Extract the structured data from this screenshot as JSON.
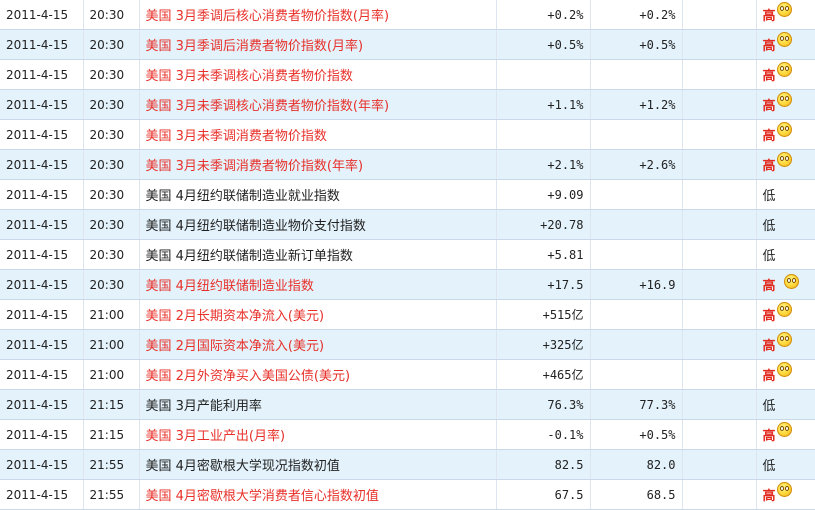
{
  "rows": [
    {
      "date": "2011-4-15",
      "time": "20:30",
      "event": "美国 3月季调后核心消费者物价指数(月率)",
      "prev": "+0.2%",
      "forecast": "+0.2%",
      "actual": "",
      "importance": "高",
      "level": "high",
      "face_far": false
    },
    {
      "date": "2011-4-15",
      "time": "20:30",
      "event": "美国 3月季调后消费者物价指数(月率)",
      "prev": "+0.5%",
      "forecast": "+0.5%",
      "actual": "",
      "importance": "高",
      "level": "high",
      "face_far": false
    },
    {
      "date": "2011-4-15",
      "time": "20:30",
      "event": "美国 3月未季调核心消费者物价指数",
      "prev": "",
      "forecast": "",
      "actual": "",
      "importance": "高",
      "level": "high",
      "face_far": false
    },
    {
      "date": "2011-4-15",
      "time": "20:30",
      "event": "美国 3月未季调核心消费者物价指数(年率)",
      "prev": "+1.1%",
      "forecast": "+1.2%",
      "actual": "",
      "importance": "高",
      "level": "high",
      "face_far": false
    },
    {
      "date": "2011-4-15",
      "time": "20:30",
      "event": "美国 3月未季调消费者物价指数",
      "prev": "",
      "forecast": "",
      "actual": "",
      "importance": "高",
      "level": "high",
      "face_far": false
    },
    {
      "date": "2011-4-15",
      "time": "20:30",
      "event": "美国 3月未季调消费者物价指数(年率)",
      "prev": "+2.1%",
      "forecast": "+2.6%",
      "actual": "",
      "importance": "高",
      "level": "high",
      "face_far": false
    },
    {
      "date": "2011-4-15",
      "time": "20:30",
      "event": "美国 4月纽约联储制造业就业指数",
      "prev": "+9.09",
      "forecast": "",
      "actual": "",
      "importance": "低",
      "level": "low",
      "face_far": false
    },
    {
      "date": "2011-4-15",
      "time": "20:30",
      "event": "美国 4月纽约联储制造业物价支付指数",
      "prev": "+20.78",
      "forecast": "",
      "actual": "",
      "importance": "低",
      "level": "low",
      "face_far": false
    },
    {
      "date": "2011-4-15",
      "time": "20:30",
      "event": "美国 4月纽约联储制造业新订单指数",
      "prev": "+5.81",
      "forecast": "",
      "actual": "",
      "importance": "低",
      "level": "low",
      "face_far": false
    },
    {
      "date": "2011-4-15",
      "time": "20:30",
      "event": "美国 4月纽约联储制造业指数",
      "prev": "+17.5",
      "forecast": "+16.9",
      "actual": "",
      "importance": "高",
      "level": "high",
      "face_far": true
    },
    {
      "date": "2011-4-15",
      "time": "21:00",
      "event": "美国 2月长期资本净流入(美元)",
      "prev": "+515亿",
      "forecast": "",
      "actual": "",
      "importance": "高",
      "level": "high",
      "face_far": false
    },
    {
      "date": "2011-4-15",
      "time": "21:00",
      "event": "美国 2月国际资本净流入(美元)",
      "prev": "+325亿",
      "forecast": "",
      "actual": "",
      "importance": "高",
      "level": "high",
      "face_far": false
    },
    {
      "date": "2011-4-15",
      "time": "21:00",
      "event": "美国 2月外资净买入美国公债(美元)",
      "prev": "+465亿",
      "forecast": "",
      "actual": "",
      "importance": "高",
      "level": "high",
      "face_far": false
    },
    {
      "date": "2011-4-15",
      "time": "21:15",
      "event": "美国 3月产能利用率",
      "prev": "76.3%",
      "forecast": "77.3%",
      "actual": "",
      "importance": "低",
      "level": "low",
      "face_far": false
    },
    {
      "date": "2011-4-15",
      "time": "21:15",
      "event": "美国 3月工业产出(月率)",
      "prev": "-0.1%",
      "forecast": "+0.5%",
      "actual": "",
      "importance": "高",
      "level": "high",
      "face_far": false
    },
    {
      "date": "2011-4-15",
      "time": "21:55",
      "event": "美国 4月密歇根大学现况指数初值",
      "prev": "82.5",
      "forecast": "82.0",
      "actual": "",
      "importance": "低",
      "level": "low",
      "face_far": false
    },
    {
      "date": "2011-4-15",
      "time": "21:55",
      "event": "美国 4月密歇根大学消费者信心指数初值",
      "prev": "67.5",
      "forecast": "68.5",
      "actual": "",
      "importance": "高",
      "level": "high",
      "face_far": false
    }
  ],
  "icons": {
    "importance_face": "smiley-face-icon"
  },
  "colors": {
    "high_text": "#e8302a",
    "row_alt_bg": "#e3f2fb",
    "border": "#c9d9e8"
  }
}
